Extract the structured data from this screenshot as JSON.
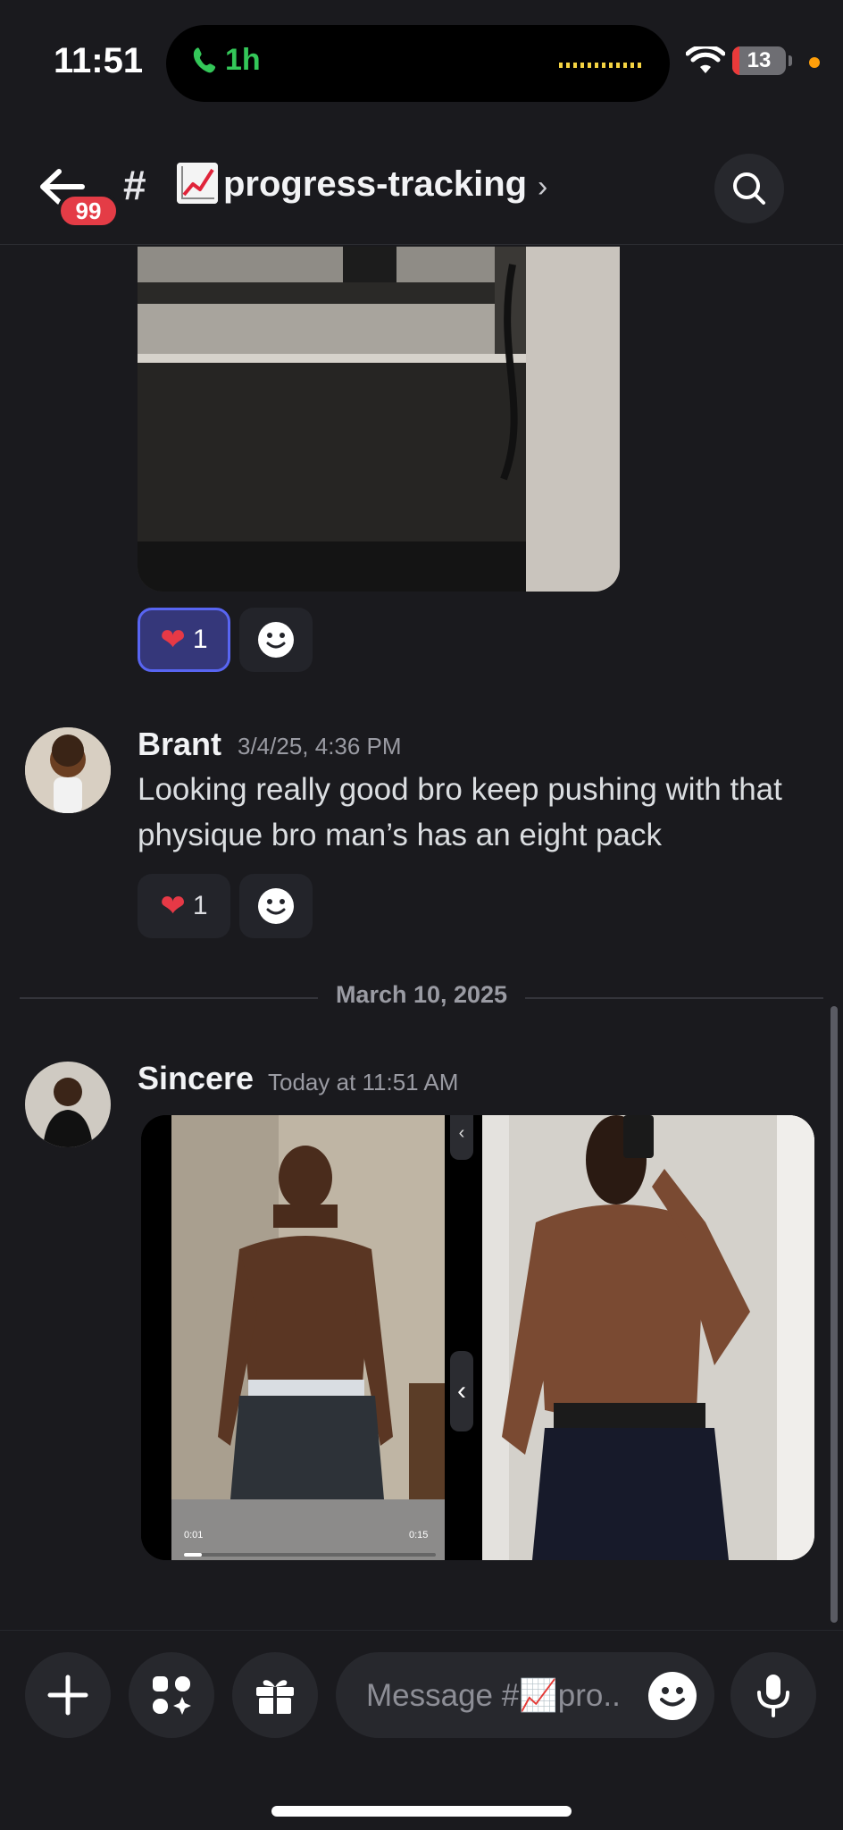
{
  "status_bar": {
    "time": "11:51",
    "call_duration": "1h",
    "battery_level": "13",
    "battery_fraction": 0.13
  },
  "header": {
    "unread_badge": "99",
    "hash": "#",
    "channel_icon": "chart-increasing-icon",
    "channel_name": "progress-tracking",
    "chevron": "›"
  },
  "messages": [
    {
      "reactions": [
        {
          "emoji": "red-heart",
          "count": "1",
          "selected": true
        }
      ]
    },
    {
      "author": "Brant",
      "timestamp": "3/4/25, 4:36 PM",
      "text": "Looking really good bro keep pushing with that physique bro man’s has an eight pack",
      "reactions": [
        {
          "emoji": "red-heart",
          "count": "1",
          "selected": false
        }
      ]
    }
  ],
  "date_divider": "March 10, 2025",
  "latest": {
    "author": "Sincere",
    "timestamp": "Today at 11:51 AM",
    "video_time_current": "0:01",
    "video_time_total": "0:15",
    "video_progress": 0.07
  },
  "composer": {
    "placeholder": "Message #📈pro..",
    "buttons": [
      "plus-icon",
      "apps-icon",
      "gift-icon",
      "microphone-icon"
    ]
  },
  "colors": {
    "background": "#1a1a1e",
    "accent": "#5865f2",
    "badge_red": "#e43c46",
    "call_green": "#34c759"
  }
}
